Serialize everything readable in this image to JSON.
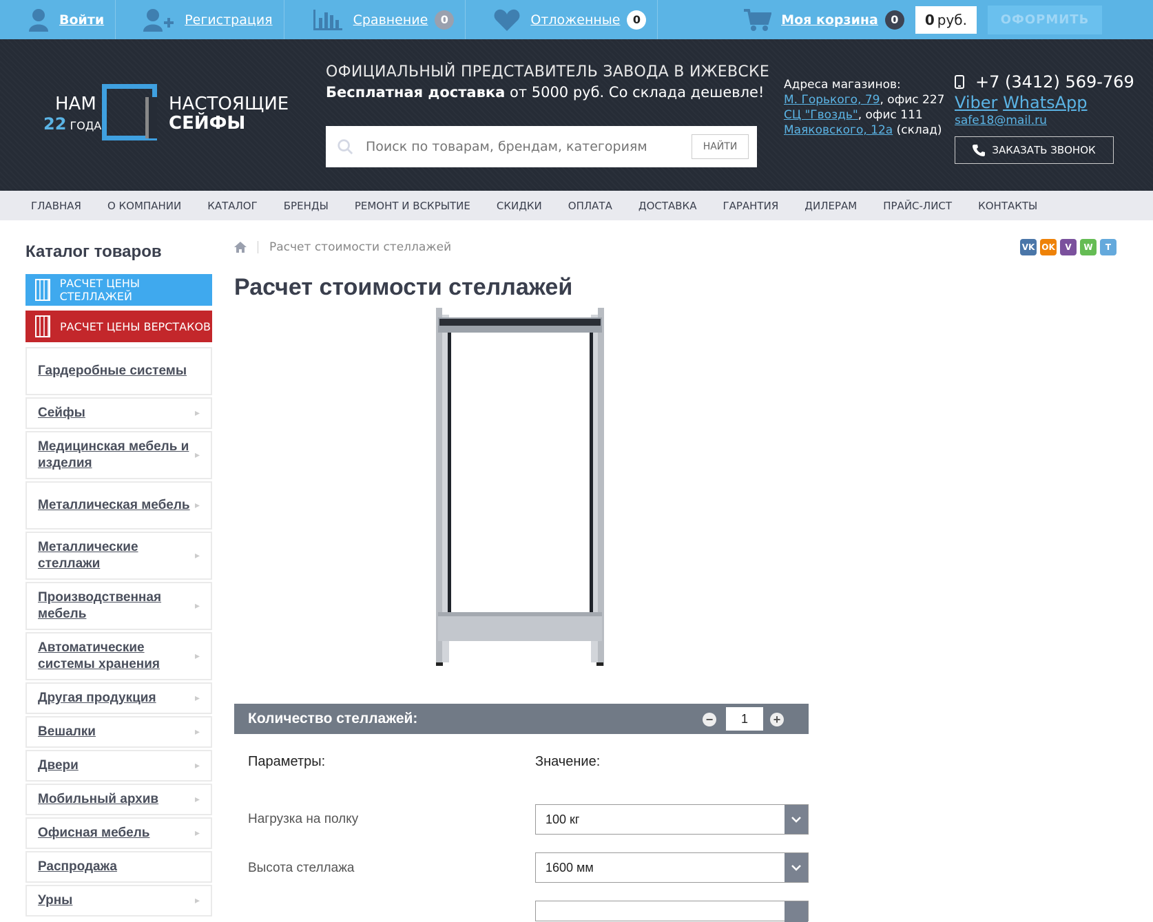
{
  "topbar": {
    "login": "Войти",
    "register": "Регистрация",
    "compare": "Сравнение",
    "compare_count": "0",
    "wishlist": "Отложенные",
    "wishlist_count": "0",
    "cart": "Моя корзина",
    "cart_count": "0",
    "sum_value": "0",
    "sum_unit": "руб.",
    "checkout": "ОФОРМИТЬ"
  },
  "logo": {
    "years_prefix": "НАМ",
    "years_num": "22",
    "years_word": "ГОДА",
    "line1": "НАСТОЯЩИЕ",
    "line2": "СЕЙФЫ"
  },
  "header": {
    "official": "ОФИЦИАЛЬНЫЙ ПРЕДСТАВИТЕЛЬ ЗАВОДА В ИЖЕВСКЕ",
    "delivery_bold": "Бесплатная доставка",
    "delivery_rest": " от 5000 руб. Со склада дешевле!",
    "search_placeholder": "Поиск по товарам, брендам, категориям",
    "search_button": "НАЙТИ",
    "addresses_title": "Адреса магазинов:",
    "addresses": [
      {
        "link": "М. Горького, 79",
        "rest": ", офис 227"
      },
      {
        "link": "СЦ \"Гвоздь\"",
        "rest": ", офис 111"
      },
      {
        "link": "Маяковского, 12а",
        "rest": " (склад)"
      }
    ],
    "phone": "+7 (3412) 569-769",
    "viber": "Viber",
    "whatsapp": "WhatsApp",
    "email": "safe18@mail.ru",
    "call_button": "ЗАКАЗАТЬ ЗВОНОК"
  },
  "nav": [
    "ГЛАВНАЯ",
    "О КОМПАНИИ",
    "КАТАЛОГ",
    "БРЕНДЫ",
    "РЕМОНТ И ВСКРЫТИЕ",
    "СКИДКИ",
    "ОПЛАТА",
    "ДОСТАВКА",
    "ГАРАНТИЯ",
    "ДИЛЕРАМ",
    "ПРАЙС-ЛИСТ",
    "КОНТАКТЫ"
  ],
  "sidebar": {
    "title": "Каталог товаров",
    "calc_shelves": "РАСЧЕТ ЦЕНЫ СТЕЛЛАЖЕЙ",
    "calc_workbench": "РАСЧЕТ ЦЕНЫ ВЕРСТАКОВ",
    "categories": [
      "Гардеробные системы",
      "Сейфы",
      "Медицинская мебель и изделия",
      "Металлическая мебель",
      "Металлические стеллажи",
      "Производственная мебель",
      "Автоматические системы хранения",
      "Другая продукция",
      "Вешалки",
      "Двери",
      "Мобильный архив",
      "Офисная мебель",
      "Распродажа",
      "Урны"
    ]
  },
  "breadcrumb": {
    "current": "Расчет стоимости стеллажей"
  },
  "share": [
    "VK",
    "OK",
    "V",
    "W",
    "T"
  ],
  "main": {
    "title": "Расчет стоимости стеллажей",
    "qty_label": "Количество стеллажей:",
    "qty_value": "1",
    "qty_minus": "−",
    "qty_plus": "+",
    "param_header": "Параметры:",
    "value_header": "Значение:",
    "params": [
      {
        "label": "Нагрузка на полку",
        "value": "100 кг"
      },
      {
        "label": "Высота стеллажа",
        "value": "1600 мм"
      }
    ]
  },
  "colors": {
    "accent": "#5bb4e5",
    "header_bg": "#262c36",
    "red": "#c3272b"
  }
}
